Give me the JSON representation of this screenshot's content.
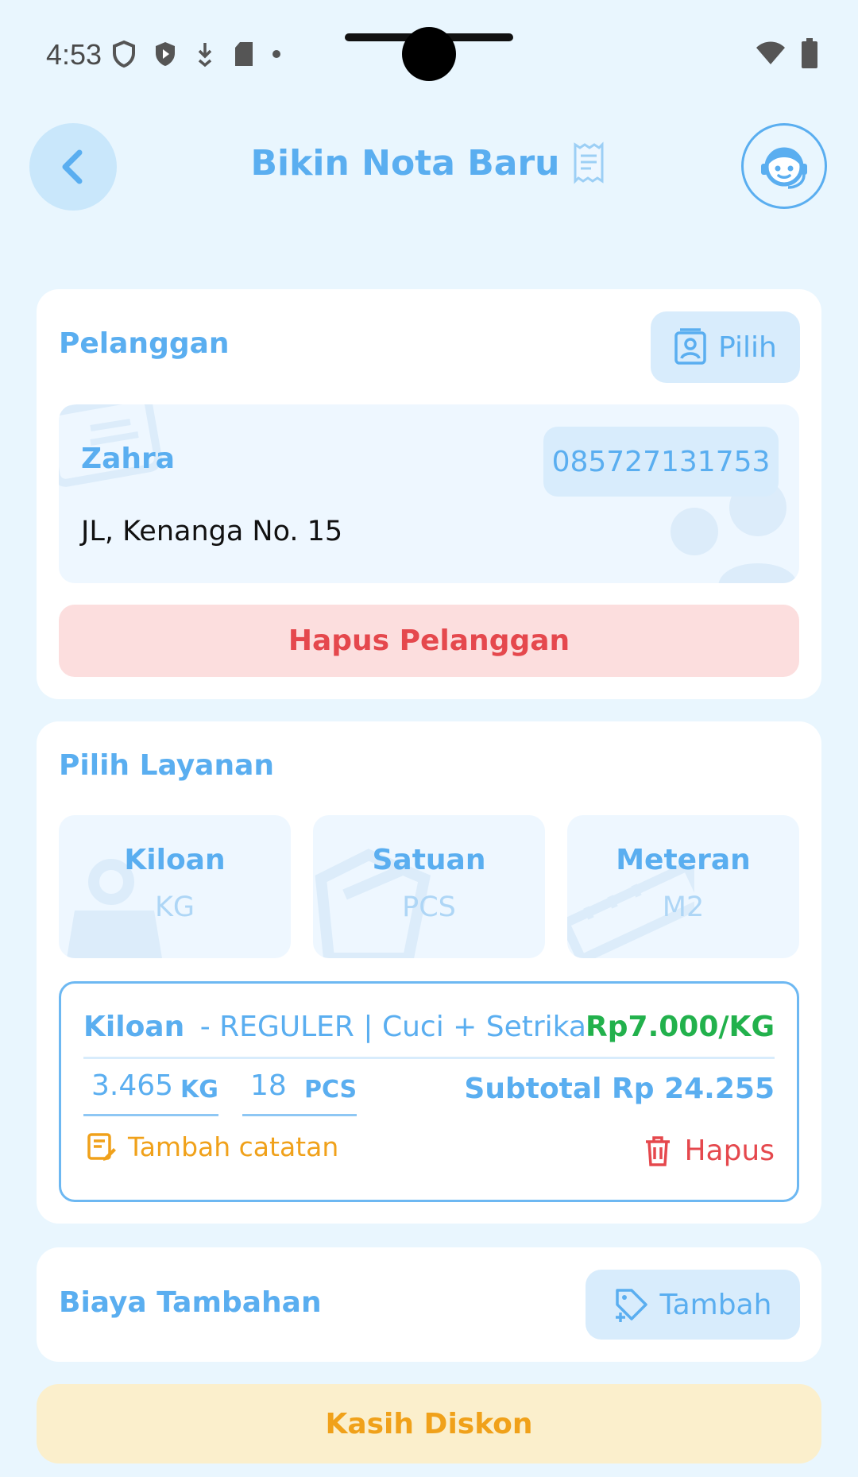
{
  "status_bar": {
    "time": "4:53"
  },
  "header": {
    "title": "Bikin Nota Baru"
  },
  "customer_section": {
    "title": "Pelanggan",
    "choose_label": "Pilih",
    "customer": {
      "name": "Zahra",
      "phone": "085727131753",
      "address": "JL, Kenanga No. 15"
    },
    "delete_label": "Hapus Pelanggan"
  },
  "service_section": {
    "title": "Pilih Layanan",
    "options": [
      {
        "name": "Kiloan",
        "unit": "KG"
      },
      {
        "name": "Satuan",
        "unit": "PCS"
      },
      {
        "name": "Meteran",
        "unit": "M2"
      }
    ],
    "selected_item": {
      "type": "Kiloan",
      "description": "- REGULER | Cuci + Setrika",
      "price": "Rp7.000/KG",
      "weight_value": "3.465",
      "weight_unit": "KG",
      "pcs_value": "18",
      "pcs_unit": "PCS",
      "subtotal": "Subtotal Rp 24.255",
      "add_note_label": "Tambah catatan",
      "delete_label": "Hapus"
    }
  },
  "extra_cost_section": {
    "title": "Biaya Tambahan",
    "add_label": "Tambah"
  },
  "discount_label": "Kasih Diskon",
  "colors": {
    "accent": "#5aaef0",
    "danger": "#e5484d",
    "success": "#22b14c",
    "warning": "#f0a11a"
  }
}
